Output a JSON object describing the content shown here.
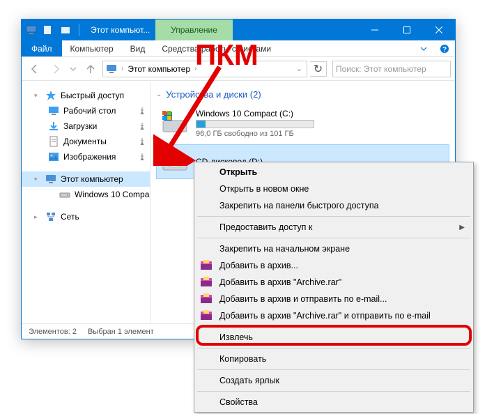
{
  "annotation": {
    "label": "ПКМ"
  },
  "titlebar": {
    "title": "Этот компьют...",
    "manage_tab": "Управление"
  },
  "ribbon": {
    "file": "Файл",
    "tabs": [
      "Компьютер",
      "Вид"
    ],
    "tools_tab": "Средства работы с дисками"
  },
  "address": {
    "location": "Этот компьютер",
    "chevron": "›",
    "refresh_icon": "↻"
  },
  "search": {
    "placeholder": "Поиск: Этот компьютер"
  },
  "nav": {
    "quick_access": "Быстрый доступ",
    "desktop": "Рабочий стол",
    "downloads": "Загрузки",
    "documents": "Документы",
    "pictures": "Изображения",
    "this_pc": "Этот компьютер",
    "drive_c": "Windows 10 Compa",
    "network": "Сеть"
  },
  "content": {
    "group_title": "Устройства и диски (2)",
    "drive_c": {
      "name": "Windows 10 Compact (C:)",
      "free": "96,0 ГБ свободно из 101 ГБ"
    },
    "drive_d": {
      "name": "CD-дисковод (D:)"
    }
  },
  "status": {
    "items": "Элементов: 2",
    "selected": "Выбран 1 элемент"
  },
  "ctx": {
    "open": "Открыть",
    "open_new": "Открыть в новом окне",
    "pin_quick": "Закрепить на панели быстрого доступа",
    "grant_access": "Предоставить доступ к",
    "pin_start": "Закрепить на начальном экране",
    "rar1": "Добавить в архив...",
    "rar2": "Добавить в архив \"Archive.rar\"",
    "rar3": "Добавить в архив и отправить по e-mail...",
    "rar4": "Добавить в архив \"Archive.rar\" и отправить по e-mail",
    "eject": "Извлечь",
    "copy": "Копировать",
    "shortcut": "Создать ярлык",
    "properties": "Свойства"
  }
}
